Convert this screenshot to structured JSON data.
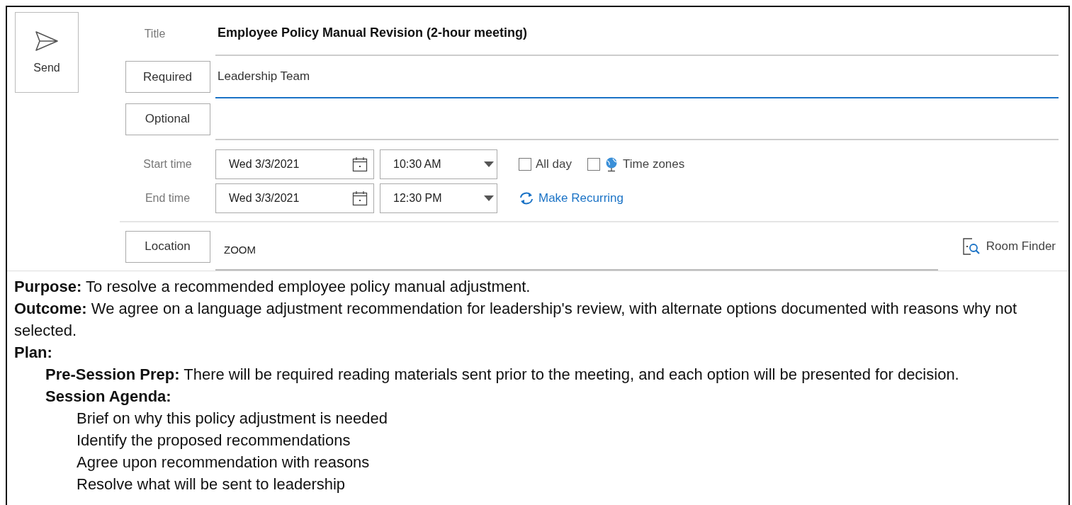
{
  "send_button": {
    "label": "Send"
  },
  "title": {
    "label": "Title",
    "value": "Employee Policy Manual Revision (2-hour meeting)"
  },
  "required": {
    "label": "Required",
    "value": "Leadership Team",
    "focused": true
  },
  "optional": {
    "label": "Optional",
    "focused": false
  },
  "start": {
    "label": "Start time",
    "date": "Wed 3/3/2021",
    "time": "10:30 AM"
  },
  "end": {
    "label": "End time",
    "date": "Wed 3/3/2021",
    "time": "12:30 PM"
  },
  "all_day": {
    "label": "All day",
    "checked": false
  },
  "time_zones": {
    "label": "Time zones",
    "checked": false
  },
  "make_recurring": "Make Recurring",
  "location": {
    "label": "Location",
    "value": "ZOOM"
  },
  "room_finder": "Room Finder",
  "body": [
    {
      "text": "**Purpose:** To resolve a recommended employee policy manual adjustment."
    },
    {
      "text": "**Outcome:** We agree on a language adjustment recommendation for leadership's review, with alternate options documented with reasons why not selected."
    },
    {
      "text": "**Plan:**",
      "children": [
        {
          "text": "**Pre-Session Prep:** There will be required reading materials sent prior to the meeting, and each option will be presented for decision."
        },
        {
          "text": "**Session Agenda:**",
          "children": [
            {
              "text": "Brief on why this policy adjustment is needed"
            },
            {
              "text": "Identify the proposed recommendations"
            },
            {
              "text": "Agree upon recommendation with reasons"
            },
            {
              "text": "Resolve what will be sent to leadership"
            }
          ]
        }
      ]
    }
  ]
}
